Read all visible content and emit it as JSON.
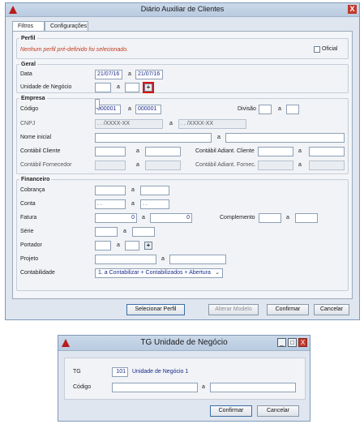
{
  "main_window": {
    "title": "Diário Auxiliar de Clientes",
    "close": "X",
    "tabs": [
      "Filtros",
      "Configurações"
    ],
    "perfil": {
      "title": "Perfil",
      "warning": "Nenhum perfil pré-definido foi selecionado.",
      "oficial": "Oficial"
    },
    "geral": {
      "title": "Geral",
      "data_label": "Data",
      "data_from": "21/07/16",
      "data_to": "21/07/16",
      "a": "a",
      "unidade_label": "Unidade de Negócio",
      "plus": "+"
    },
    "empresa": {
      "title": "Empresa",
      "codigo_label": "Código",
      "codigo_from": "000001",
      "codigo_to": "000001",
      "divisao_label": "Divisão",
      "cnpj_label": "CNPJ",
      "cnpj_mask": ". . /XXXX-XX",
      "nome_label": "Nome inicial",
      "contabil_cliente_label": "Contábil Cliente",
      "contabil_adiant_cliente_label": "Contábil Adiant. Cliente",
      "contabil_fornecedor_label": "Contábil Fornecedor",
      "contabil_adiant_fornec_label": "Contábil Adiant. Fornec."
    },
    "financeiro": {
      "title": "Financeiro",
      "cobranca_label": "Cobrança",
      "conta_label": "Conta",
      "conta_mask": ". .",
      "fatura_label": "Fatura",
      "fatura_from": "0",
      "fatura_to": "0",
      "complemento_label": "Complemento",
      "serie_label": "Série",
      "portador_label": "Portador",
      "projeto_label": "Projeto",
      "contabilidade_label": "Contabilidade",
      "contabilidade_value": "1. a Contabilizar + Contabilizados + Abertura"
    },
    "buttons": {
      "selecionar": "Selecionar Perfil",
      "alterar": "Alterar Modelo",
      "confirmar": "Confirmar",
      "cancelar": "Cancelar"
    }
  },
  "dialog": {
    "title": "TG Unidade de Negócio",
    "minimize": "_",
    "maximize": "□",
    "close": "X",
    "tg_label": "TG",
    "tg_value": "101",
    "tg_name": "Unidade de Negócio 1",
    "codigo_label": "Código",
    "a": "a",
    "confirmar": "Confirmar",
    "cancelar": "Cancelar"
  }
}
